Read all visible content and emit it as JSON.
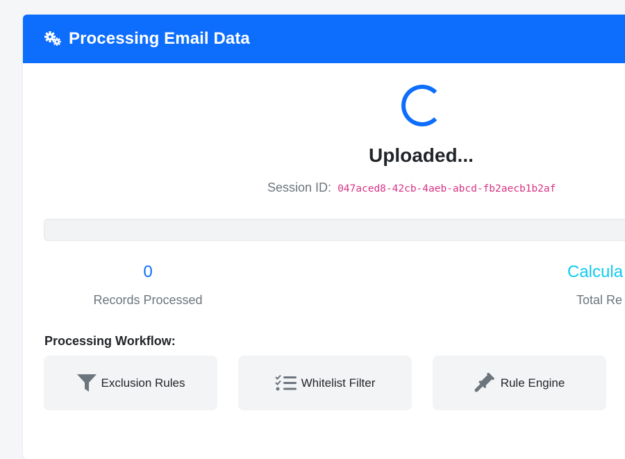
{
  "header": {
    "title": "Processing Email Data",
    "icon": "gears-icon",
    "color": "#0d6efd"
  },
  "status": {
    "title": "Uploaded...",
    "session_label": "Session ID:",
    "session_id": "047aced8-42cb-4aeb-abcd-fb2aecb1b2af"
  },
  "progress": {
    "value": 0
  },
  "stats": [
    {
      "value": "0",
      "label": "Records Processed"
    },
    {
      "value": "Calcula",
      "label": "Total Re"
    }
  ],
  "workflow": {
    "title": "Processing Workflow:",
    "steps": [
      {
        "label": "Exclusion Rules",
        "icon": "filter-icon"
      },
      {
        "label": "Whitelist Filter",
        "icon": "list-check-icon"
      },
      {
        "label": "Rule Engine",
        "icon": "gavel-icon"
      }
    ]
  }
}
